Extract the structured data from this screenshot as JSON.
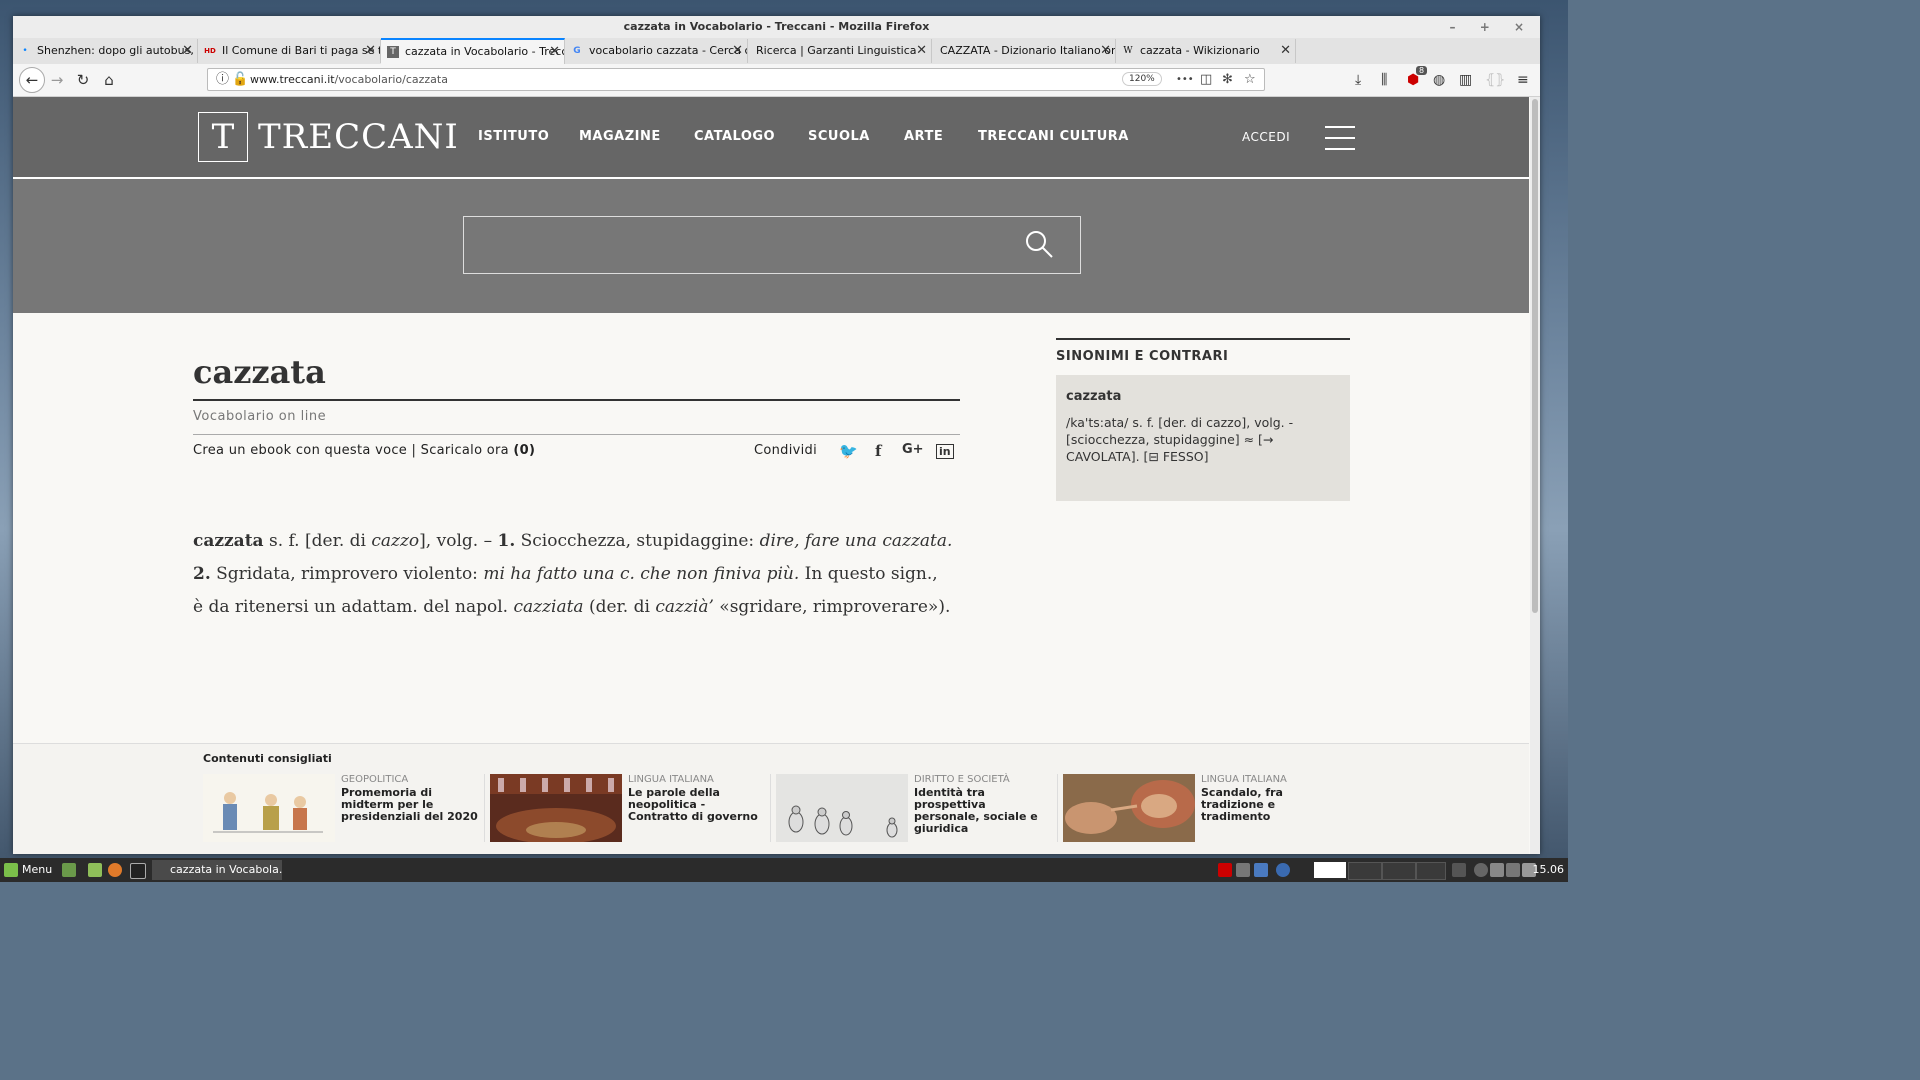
{
  "window": {
    "title": "cazzata in Vocabolario - Treccani - Mozilla Firefox",
    "controls": "– + ×"
  },
  "tabs": [
    {
      "label": "Shenzhen: dopo gli autobus, c",
      "favicon": "•",
      "active": false
    },
    {
      "label": "Il Comune di Bari ti paga se ti",
      "favicon": "HD",
      "active": false
    },
    {
      "label": "cazzata in Vocabolario - Trecc",
      "favicon": "T",
      "active": true
    },
    {
      "label": "vocabolario cazzata - Cerca c",
      "favicon": "G",
      "active": false
    },
    {
      "label": "Ricerca | Garzanti Linguistica",
      "favicon": "",
      "active": false
    },
    {
      "label": "CAZZATA - Dizionario Italiano onl",
      "favicon": "",
      "active": false
    },
    {
      "label": "cazzata - Wikizionario",
      "favicon": "W",
      "active": false
    }
  ],
  "newtab_label": "+",
  "tab_close": "✕",
  "navbar": {
    "back": "←",
    "forward": "→",
    "reload": "↻",
    "home": "⌂",
    "url_host": "www.treccani.it",
    "url_path": "/vocabolario/cazzata",
    "zoom": "120%",
    "more": "•••",
    "badge": "8"
  },
  "site": {
    "logo_mark": "T",
    "logo_text": "TRECCANI",
    "nav": [
      "ISTITUTO",
      "MAGAZINE",
      "CATALOGO",
      "SCUOLA",
      "ARTE",
      "TRECCANI CULTURA"
    ],
    "login": "ACCEDI",
    "search_placeholder": ""
  },
  "entry": {
    "word": "cazzata",
    "source": "Vocabolario on line",
    "ebook_create": "Crea un ebook con questa voce",
    "ebook_sep": " | ",
    "ebook_download": "Scaricalo ora",
    "ebook_count": "(0)",
    "share_label": "Condividi",
    "share_icons": [
      "twitter-icon",
      "facebook-icon",
      "google-plus-icon",
      "linkedin-icon"
    ],
    "share_glyphs": [
      "🐦",
      "f",
      "G+",
      "in"
    ],
    "definition": {
      "headword": "cazzata",
      "t1": " s. f. [der. di ",
      "i1": "cazzo",
      "t2": "], volg. – ",
      "n1": "1.",
      "t3": " Sciocchezza, stupidaggine: ",
      "i2": "dire, fare una cazzata.",
      "n2": " 2.",
      "t4": " Sgridata, rimprovero violento: ",
      "i3": "mi ha fatto una c. che non finiva più.",
      "t5": " In questo sign., è da ritenersi un adattam. del napol. ",
      "i4": "cazziata",
      "t6": " (der. di ",
      "i5": "cazzià’",
      "t7": " «sgridare, rimproverare»)."
    }
  },
  "sidebar": {
    "title": "SINONIMI E CONTRARI",
    "word": "cazzata",
    "definition": "/ka'ts:ata/ s. f. [der. di cazzo], volg. - [sciocchezza, stupidaggine] ≈ [→ CAVOLATA]. [⊟ FESSO]"
  },
  "recommended": {
    "title": "Contenuti consigliati",
    "items": [
      {
        "category": "GEOPOLITICA",
        "headline": "Promemoria di midterm per le presidenziali del 2020"
      },
      {
        "category": "LINGUA ITALIANA",
        "headline": "Le parole della neopolitica - Contratto di governo"
      },
      {
        "category": "DIRITTO E SOCIETÀ",
        "headline": "Identità tra prospettiva personale, sociale e giuridica"
      },
      {
        "category": "LINGUA ITALIANA",
        "headline": "Scandalo, fra tradizione e tradimento"
      }
    ]
  },
  "taskbar": {
    "menu": "Menu",
    "app": "cazzata in Vocabola...",
    "clock": "15.06"
  },
  "colors": {
    "header_bg": "#666666",
    "search_band": "#777777",
    "accent_tab": "#0a84ff",
    "sidebar_box": "#e3e1dc"
  }
}
